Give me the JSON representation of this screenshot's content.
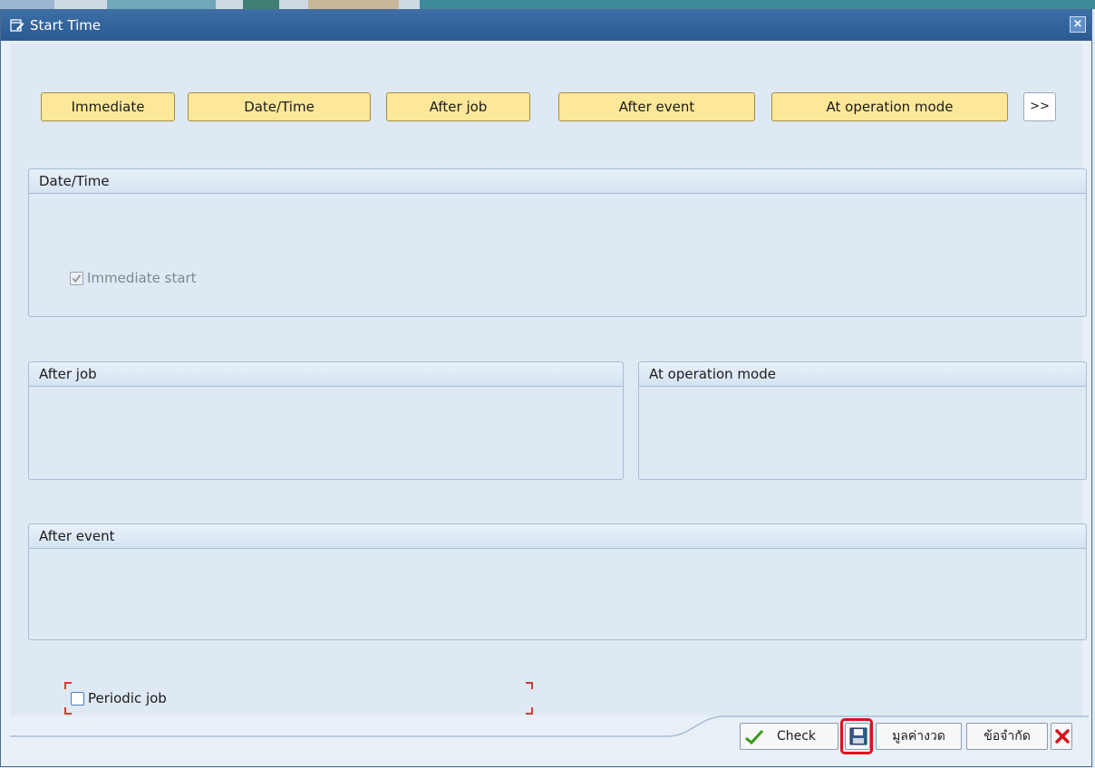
{
  "window": {
    "title": "Start Time",
    "close_label": "×"
  },
  "toolbar": {
    "immediate": "Immediate",
    "date_time": "Date/Time",
    "after_job": "After job",
    "after_event": "After event",
    "at_operation_mode": "At operation mode",
    "more": ">>"
  },
  "groups": {
    "date_time": {
      "title": "Date/Time",
      "immediate_start_label": "Immediate start",
      "immediate_start_checked": true
    },
    "after_job": {
      "title": "After job"
    },
    "at_operation_mode": {
      "title": "At operation mode"
    },
    "after_event": {
      "title": "After event"
    }
  },
  "periodic_job": {
    "label": "Periodic job",
    "checked": false
  },
  "footer": {
    "check_label": "Check",
    "values_label": "มูลค่างวด",
    "restrictions_label": "ข้อจำกัด"
  },
  "colors": {
    "titlebar": "#2a5a92",
    "toolbar_button": "#fde89a",
    "highlight": "#e0101c",
    "check_icon": "#3a9b1a",
    "cancel_icon": "#d4141c"
  },
  "icons": [
    "window-edit-icon",
    "close-icon",
    "checkmark-icon",
    "save-icon",
    "cancel-x-icon"
  ]
}
